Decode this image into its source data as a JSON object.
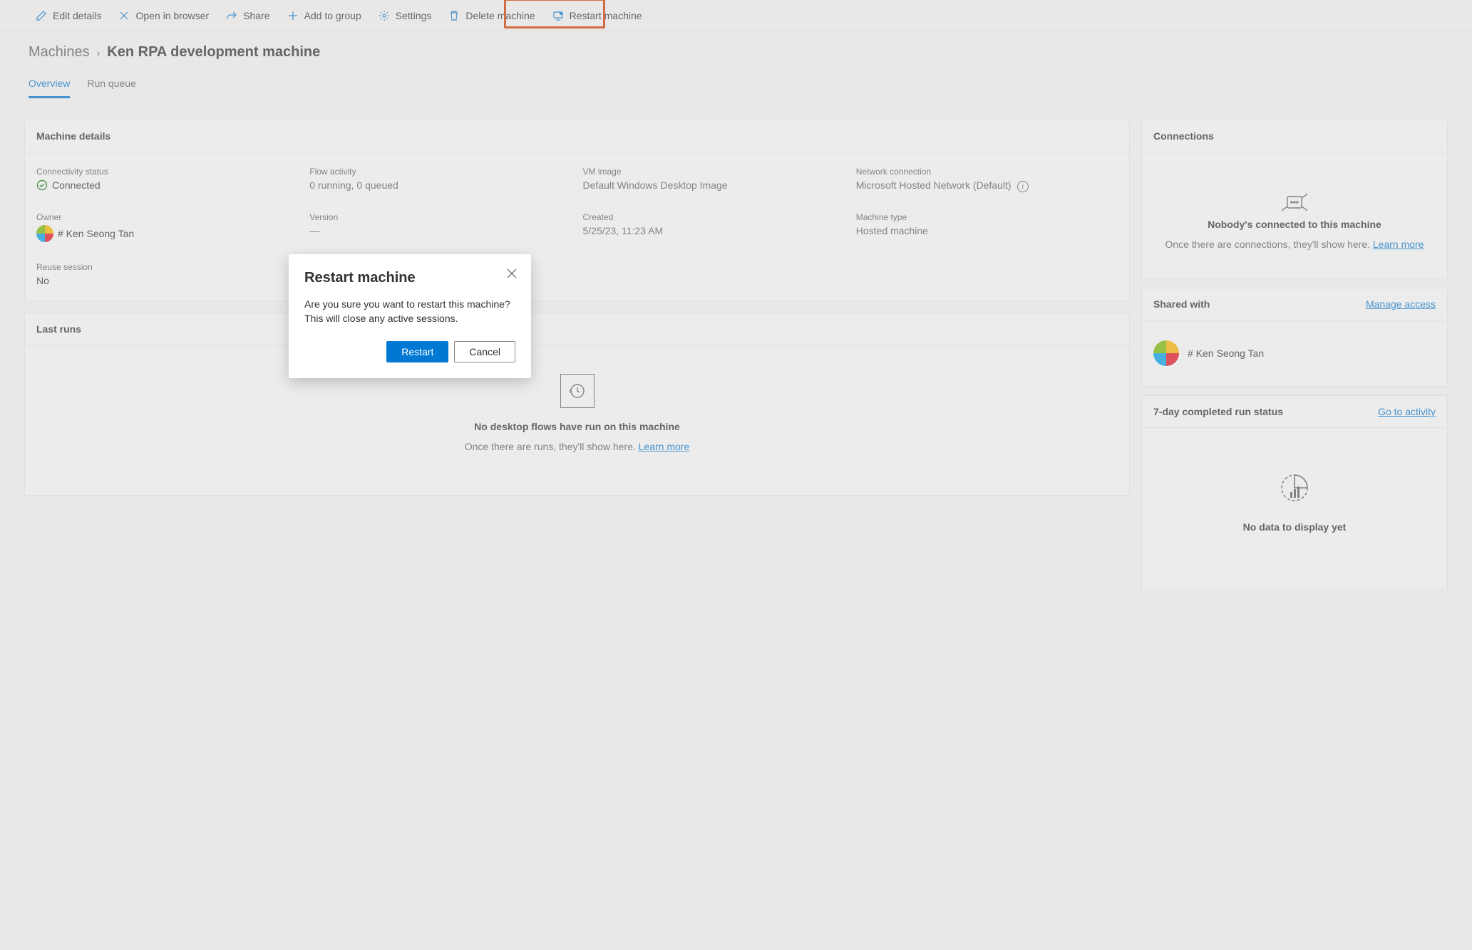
{
  "toolbar": {
    "edit": "Edit details",
    "open_browser": "Open in browser",
    "share": "Share",
    "add_group": "Add to group",
    "settings": "Settings",
    "delete": "Delete machine",
    "restart": "Restart machine"
  },
  "breadcrumb": {
    "root": "Machines",
    "current": "Ken RPA development machine"
  },
  "tabs": {
    "overview": "Overview",
    "run_queue": "Run queue"
  },
  "details": {
    "header": "Machine details",
    "connectivity_label": "Connectivity status",
    "connectivity_value": "Connected",
    "flow_label": "Flow activity",
    "flow_value": "0 running, 0 queued",
    "vm_label": "VM image",
    "vm_value": "Default Windows Desktop Image",
    "network_label": "Network connection",
    "network_value": "Microsoft Hosted Network (Default)",
    "owner_label": "Owner",
    "owner_value": "# Ken Seong Tan",
    "version_label": "Version",
    "version_value": "—",
    "created_label": "Created",
    "created_value": "5/25/23, 11:23 AM",
    "type_label": "Machine type",
    "type_value": "Hosted machine",
    "reuse_label": "Reuse session",
    "reuse_value": "No"
  },
  "last_runs": {
    "header": "Last runs",
    "empty_title": "No desktop flows have run on this machine",
    "empty_sub": "Once there are runs, they'll show here. ",
    "learn_more": "Learn more"
  },
  "connections": {
    "header": "Connections",
    "empty_title": "Nobody's connected to this machine",
    "empty_sub": "Once there are connections, they'll show here. ",
    "learn_more": "Learn more"
  },
  "shared": {
    "header": "Shared with",
    "manage": "Manage access",
    "user": "# Ken Seong Tan"
  },
  "run_status": {
    "header": "7-day completed run status",
    "go_to": "Go to activity",
    "empty": "No data to display yet"
  },
  "dialog": {
    "title": "Restart machine",
    "body": "Are you sure you want to restart this machine? This will close any active sessions.",
    "primary": "Restart",
    "secondary": "Cancel"
  }
}
